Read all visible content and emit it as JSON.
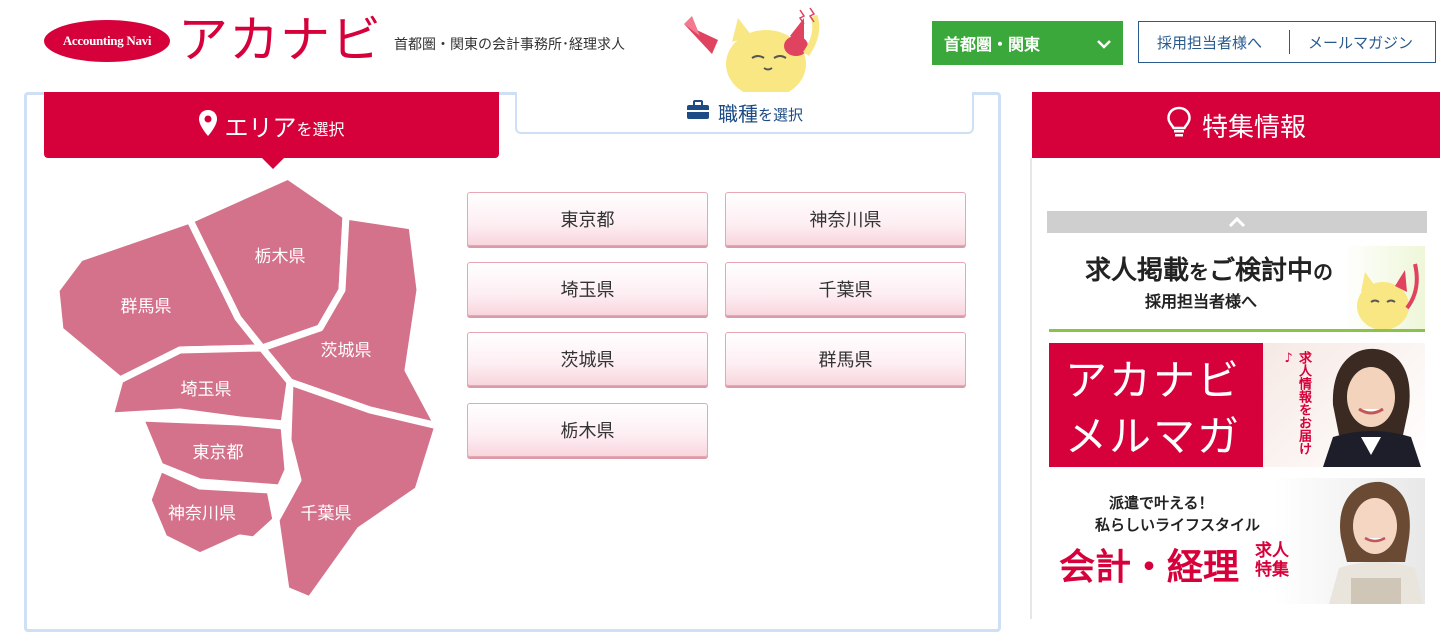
{
  "header": {
    "logo_text": "Accounting Navi",
    "logo_kana": "アカナビ",
    "tagline": "首都圏・関東の会計事務所･経理求人",
    "region_select": {
      "value": "首都圏・関東",
      "icon": "chevron-down-icon"
    },
    "links": [
      "採用担当者様へ",
      "メールマガジン"
    ]
  },
  "tabs": {
    "area": {
      "label": "エリア",
      "suffix": "を選択",
      "icon": "map-pin-icon"
    },
    "job": {
      "label": "職種",
      "suffix": "を選択",
      "icon": "briefcase-icon"
    }
  },
  "map_labels": [
    "栃木県",
    "群馬県",
    "茨城県",
    "埼玉県",
    "東京都",
    "神奈川県",
    "千葉県"
  ],
  "prefectures": [
    "東京都",
    "神奈川県",
    "埼玉県",
    "千葉県",
    "茨城県",
    "群馬県",
    "栃木県"
  ],
  "feature": {
    "title": "特集情報",
    "icon": "lightbulb-icon",
    "banners": [
      {
        "line1a": "求人掲載",
        "line1b": "を",
        "line1c": "ご検討中",
        "line1d": "の",
        "line2": "採用担当者様へ"
      },
      {
        "line1": "アカナビ",
        "line2": "メルマガ",
        "side": "求人情報をお届け♪"
      },
      {
        "line1": "派遣で叶える！",
        "line2": "私らしいライフスタイル",
        "line3": "会計・経理",
        "line4": "求人特集"
      }
    ]
  },
  "colors": {
    "brand": "#d6003a",
    "green": "#3aa83a",
    "map_fill": "#d3728a",
    "link_blue": "#2a5a8c"
  }
}
